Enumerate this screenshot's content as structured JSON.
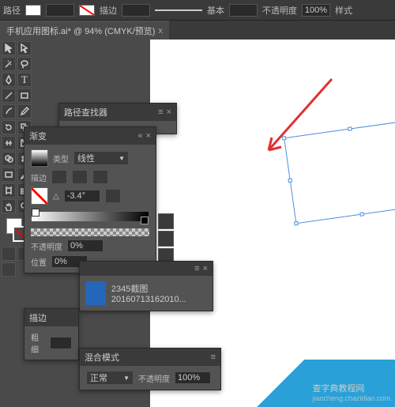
{
  "topbar": {
    "path_label": "路径",
    "fill_label": "填色",
    "stroke_label": "描边",
    "stroke_preset": "基本",
    "opacity_label": "不透明度",
    "opacity_value": "100%",
    "style_label": "样式"
  },
  "tab": {
    "title": "手机应用图标.ai* @ 94% (CMYK/预览)",
    "close": "x"
  },
  "tools": [
    "select",
    "direct",
    "wand",
    "lasso",
    "pen",
    "type",
    "line",
    "rect",
    "brush",
    "pencil",
    "rotate",
    "scale",
    "width",
    "warp",
    "mesh",
    "gradient",
    "eyedrop",
    "blend",
    "crop",
    "erase",
    "scissors",
    "hand",
    "zoom"
  ],
  "panel_pathfinder": {
    "title": "路径查找器"
  },
  "panel_gradient": {
    "tab_label": "渐变",
    "type_label": "类型",
    "type_value": "线性",
    "stroke_label": "描边",
    "angle_label": "△",
    "angle_value": "-3.4°",
    "opacity_label": "不透明度",
    "opacity_value": "0%",
    "position_label": "位置",
    "position_value": "0%"
  },
  "panel_links": {
    "item_name": "2345截图20160713162010..."
  },
  "panel_stroke": {
    "tab_label": "描边",
    "weight_label": "粗细"
  },
  "panel_blend": {
    "title": "混合模式",
    "mode_value": "正常",
    "opacity_label": "不透明度",
    "opacity_value": "100%"
  },
  "watermark": {
    "main": "查字典教程网",
    "sub": "jiaocheng.chazidian.com"
  }
}
